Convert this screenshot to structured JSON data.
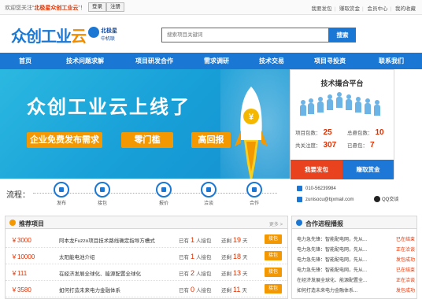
{
  "topbar": {
    "welcome_prefix": "欢迎您关注“",
    "welcome_site": "北极星众创工业云",
    "welcome_suffix": "”！",
    "login": "登录",
    "register": "注册",
    "links": [
      "我要发包",
      "赚取赏金",
      "会员中心",
      "我的收藏"
    ]
  },
  "header": {
    "logo_main": "众创工业",
    "logo_accent": "云",
    "partner_name": "北极星",
    "partner_sub": "中机联",
    "search_placeholder": "搜索项目关键词",
    "search_button": "搜索"
  },
  "nav": {
    "items": [
      "首页",
      "技术问题求解",
      "项目研发合作",
      "需求调研",
      "技术交易",
      "项目寻投资",
      "联系我们"
    ]
  },
  "banner": {
    "title": "众创工业云上线了",
    "tags": [
      "企业免费发布需求",
      "零门槛",
      "高回报"
    ],
    "coin_symbol": "¥"
  },
  "platform": {
    "title": "技术撮合平台",
    "stats": [
      {
        "label": "项目包数：",
        "value": "25"
      },
      {
        "label": "总悬包数：",
        "value": "10"
      },
      {
        "label": "共关注度：",
        "value": "307"
      },
      {
        "label": "已悬包：",
        "value": "7"
      }
    ],
    "btn_post": "我要发包",
    "btn_earn": "赚取赏金"
  },
  "process": {
    "label": "流程：",
    "steps": [
      "发布",
      "接包",
      "报价",
      "洽谈",
      "合作"
    ]
  },
  "contact": {
    "phone": "010-56239984",
    "email": "zunisocu@bjxmail.com",
    "qq": "QQ交谈"
  },
  "projects": {
    "title": "推荐项目",
    "more": "更多 >",
    "bid_prefix": "已有",
    "bid_suffix": "人接包",
    "days_prefix": "还剩",
    "days_suffix": "天",
    "action": "接包",
    "rows": [
      {
        "price": "￥3000",
        "name": "阿本龙Fuzzo项目技术路线确定指导方槽式",
        "bids": "1",
        "days": "19"
      },
      {
        "price": "￥10000",
        "name": "太阳能电池介绍",
        "bids": "1",
        "days": "18"
      },
      {
        "price": "￥111",
        "name": "在经济发展全球化、能源配置全球化",
        "bids": "2",
        "days": "13"
      },
      {
        "price": "￥3580",
        "name": "如何打造未来电力金融体系",
        "bids": "0",
        "days": "11"
      }
    ]
  },
  "progress": {
    "title": "合作进程播报",
    "rows": [
      {
        "text": "电力急先锋：智能配电网，先从...",
        "status": "已在结束"
      },
      {
        "text": "电力急先锋：智能配电网，先从...",
        "status": "正在洽谈"
      },
      {
        "text": "电力急先锋：智能配电网，先从...",
        "status": "发包成功"
      },
      {
        "text": "电力急先锋：智能配电网，先从...",
        "status": "已在结束"
      },
      {
        "text": "在经济发展全球化、能源配置全...",
        "status": "正在洽谈"
      },
      {
        "text": "如何打造未来电力金融体系...",
        "status": "发包成功"
      }
    ]
  },
  "colors": {
    "brand_blue": "#1a78d4",
    "accent_orange": "#f39800",
    "highlight_red": "#e03000",
    "post_red": "#e8431e",
    "earn_blue": "#1d77d6"
  }
}
